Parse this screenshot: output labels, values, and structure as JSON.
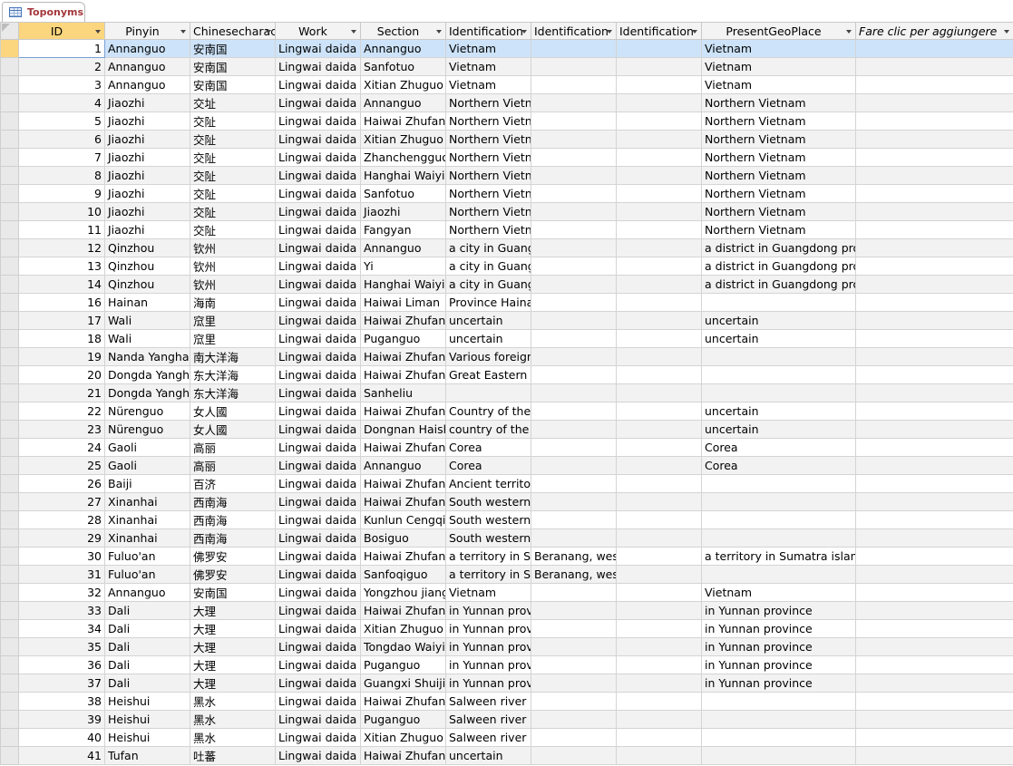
{
  "tab": {
    "label": "Toponyms",
    "icon": "table-icon"
  },
  "columns": [
    "ID",
    "Pinyin",
    "Chinesecharacters",
    "Work",
    "Section",
    "Identification",
    "Identification",
    "Identification",
    "PresentGeoPlace"
  ],
  "add_column_label": "Fare clic per aggiungere",
  "rows": [
    [
      "1",
      "Annanguo",
      "安南国",
      "Lingwai daida",
      "Annanguo",
      "Vietnam",
      "",
      "",
      "Vietnam"
    ],
    [
      "2",
      "Annanguo",
      "安南国",
      "Lingwai daida",
      "Sanfotuo",
      "Vietnam",
      "",
      "",
      "Vietnam"
    ],
    [
      "3",
      "Annanguo",
      "安南国",
      "Lingwai daida",
      "Xitian Zhuguo",
      "Vietnam",
      "",
      "",
      "Vietnam"
    ],
    [
      "4",
      "Jiaozhi",
      "交址",
      "Lingwai daida",
      "Annanguo",
      "Northern Vietnam",
      "",
      "",
      "Northern Vietnam"
    ],
    [
      "5",
      "Jiaozhi",
      "交阯",
      "Lingwai daida",
      "Haiwai Zhufan",
      "Northern Vietnam",
      "",
      "",
      "Northern Vietnam"
    ],
    [
      "6",
      "Jiaozhi",
      "交阯",
      "Lingwai daida",
      "Xitian Zhuguo",
      "Northern Vietnam",
      "",
      "",
      "Northern Vietnam"
    ],
    [
      "7",
      "Jiaozhi",
      "交阯",
      "Lingwai daida",
      "Zhanchengguo",
      "Northern Vietnam",
      "",
      "",
      "Northern Vietnam"
    ],
    [
      "8",
      "Jiaozhi",
      "交阯",
      "Lingwai daida",
      "Hanghai Waiyi",
      "Northern Vietnam",
      "",
      "",
      "Northern Vietnam"
    ],
    [
      "9",
      "Jiaozhi",
      "交阯",
      "Lingwai daida",
      "Sanfotuo",
      "Northern Vietnam",
      "",
      "",
      "Northern Vietnam"
    ],
    [
      "10",
      "Jiaozhi",
      "交阯",
      "Lingwai daida",
      "Jiaozhi",
      "Northern Vietnam",
      "",
      "",
      "Northern Vietnam"
    ],
    [
      "11",
      "Jiaozhi",
      "交阯",
      "Lingwai daida",
      "Fangyan",
      "Northern Vietnam",
      "",
      "",
      "Northern Vietnam"
    ],
    [
      "12",
      "Qinzhou",
      "钦州",
      "Lingwai daida",
      "Annanguo",
      "a city in Guangdong",
      "",
      "",
      "a district in Guangdong province"
    ],
    [
      "13",
      "Qinzhou",
      "钦州",
      "Lingwai daida",
      "Yi",
      "a city in Guangdong",
      "",
      "",
      "a district in Guangdong province"
    ],
    [
      "14",
      "Qinzhou",
      "钦州",
      "Lingwai daida",
      "Hanghai Waiyi",
      "a city in Guangdong",
      "",
      "",
      "a district in Guangdong province"
    ],
    [
      "16",
      "Hainan",
      "海南",
      "Lingwai daida",
      "Haiwai Liman",
      "Province Hainan",
      "",
      "",
      ""
    ],
    [
      "17",
      "Wali",
      "窊里",
      "Lingwai daida",
      "Haiwai Zhufan",
      "uncertain",
      "",
      "",
      "uncertain"
    ],
    [
      "18",
      "Wali",
      "窊里",
      "Lingwai daida",
      "Puganguo",
      "uncertain",
      "",
      "",
      "uncertain"
    ],
    [
      "19",
      "Nanda Yanghai",
      "南大洋海",
      "Lingwai daida",
      "Haiwai Zhufan",
      "Various foreign",
      "",
      "",
      ""
    ],
    [
      "20",
      "Dongda Yanghai",
      "东大洋海",
      "Lingwai daida",
      "Haiwai Zhufan",
      "Great Eastern Ocean",
      "",
      "",
      ""
    ],
    [
      "21",
      "Dongda Yanghai",
      "东大洋海",
      "Lingwai daida",
      "Sanheliu",
      "",
      "",
      "",
      ""
    ],
    [
      "22",
      "Nürenguo",
      "女人國",
      "Lingwai daida",
      "Haiwai Zhufan",
      "Country of the",
      "",
      "",
      "uncertain"
    ],
    [
      "23",
      "Nürenguo",
      "女人國",
      "Lingwai daida",
      "Dongnan Haishang",
      "country of the",
      "",
      "",
      "uncertain"
    ],
    [
      "24",
      "Gaoli",
      "高丽",
      "Lingwai daida",
      "Haiwai Zhufan",
      "Corea",
      "",
      "",
      "Corea"
    ],
    [
      "25",
      "Gaoli",
      "高丽",
      "Lingwai daida",
      "Annanguo",
      "Corea",
      "",
      "",
      "Corea"
    ],
    [
      "26",
      "Baiji",
      "百济",
      "Lingwai daida",
      "Haiwai Zhufan",
      "Ancient territory",
      "",
      "",
      ""
    ],
    [
      "27",
      "Xinanhai",
      "西南海",
      "Lingwai daida",
      "Haiwai Zhufan",
      "South western",
      "",
      "",
      ""
    ],
    [
      "28",
      "Xinanhai",
      "西南海",
      "Lingwai daida",
      "Kunlun Cengqi",
      "South western",
      "",
      "",
      ""
    ],
    [
      "29",
      "Xinanhai",
      "西南海",
      "Lingwai daida",
      "Bosiguo",
      "South western",
      "",
      "",
      ""
    ],
    [
      "30",
      "Fuluo'an",
      "佛罗安",
      "Lingwai daida",
      "Haiwai Zhufan",
      "a territory in Sumatra",
      "Beranang, west",
      "",
      "a territory in Sumatra island"
    ],
    [
      "31",
      "Fuluo'an",
      "佛罗安",
      "Lingwai daida",
      "Sanfoqiguo",
      "a territory in Sumatra",
      "Beranang, west",
      "",
      ""
    ],
    [
      "32",
      "Annanguo",
      "安南国",
      "Lingwai daida",
      "Yongzhou jiang",
      "Vietnam",
      "",
      "",
      "Vietnam"
    ],
    [
      "33",
      "Dali",
      "大理",
      "Lingwai daida",
      "Haiwai Zhufan",
      "in Yunnan province",
      "",
      "",
      "in Yunnan province"
    ],
    [
      "34",
      "Dali",
      "大理",
      "Lingwai daida",
      "Xitian Zhuguo",
      "in Yunnan province",
      "",
      "",
      "in Yunnan province"
    ],
    [
      "35",
      "Dali",
      "大理",
      "Lingwai daida",
      "Tongdao Waiyi",
      "in Yunnan province",
      "",
      "",
      "in Yunnan province"
    ],
    [
      "36",
      "Dali",
      "大理",
      "Lingwai daida",
      "Puganguo",
      "in Yunnan province",
      "",
      "",
      "in Yunnan province"
    ],
    [
      "37",
      "Dali",
      "大理",
      "Lingwai daida",
      "Guangxi Shuiji",
      "in Yunnan province",
      "",
      "",
      "in Yunnan province"
    ],
    [
      "38",
      "Heishui",
      "黑水",
      "Lingwai daida",
      "Haiwai Zhufan",
      "Salween river",
      "",
      "",
      ""
    ],
    [
      "39",
      "Heishui",
      "黑水",
      "Lingwai daida",
      "Puganguo",
      "Salween river",
      "",
      "",
      ""
    ],
    [
      "40",
      "Heishui",
      "黑水",
      "Lingwai daida",
      "Xitian Zhuguo",
      "Salween river",
      "",
      "",
      ""
    ],
    [
      "41",
      "Tufan",
      "吐蕃",
      "Lingwai daida",
      "Haiwai Zhufan",
      "uncertain",
      "",
      "",
      ""
    ]
  ]
}
